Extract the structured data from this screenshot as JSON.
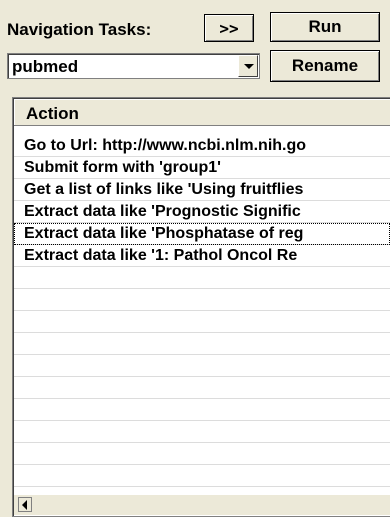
{
  "toolbar": {
    "nav_tasks_label": "Navigation Tasks:",
    "expand_label": ">>",
    "run_label": "Run",
    "rename_label": "Rename"
  },
  "task_select": {
    "value": "pubmed"
  },
  "actions_list": {
    "header": "Action",
    "rows": [
      "Go to Url: http://www.ncbi.nlm.nih.go",
      "Submit form with 'group1'",
      "Get a list of links like 'Using fruitflies",
      "Extract data like 'Prognostic Signific",
      "Extract data like 'Phosphatase of reg",
      "Extract data like '1: Pathol Oncol Re"
    ]
  }
}
